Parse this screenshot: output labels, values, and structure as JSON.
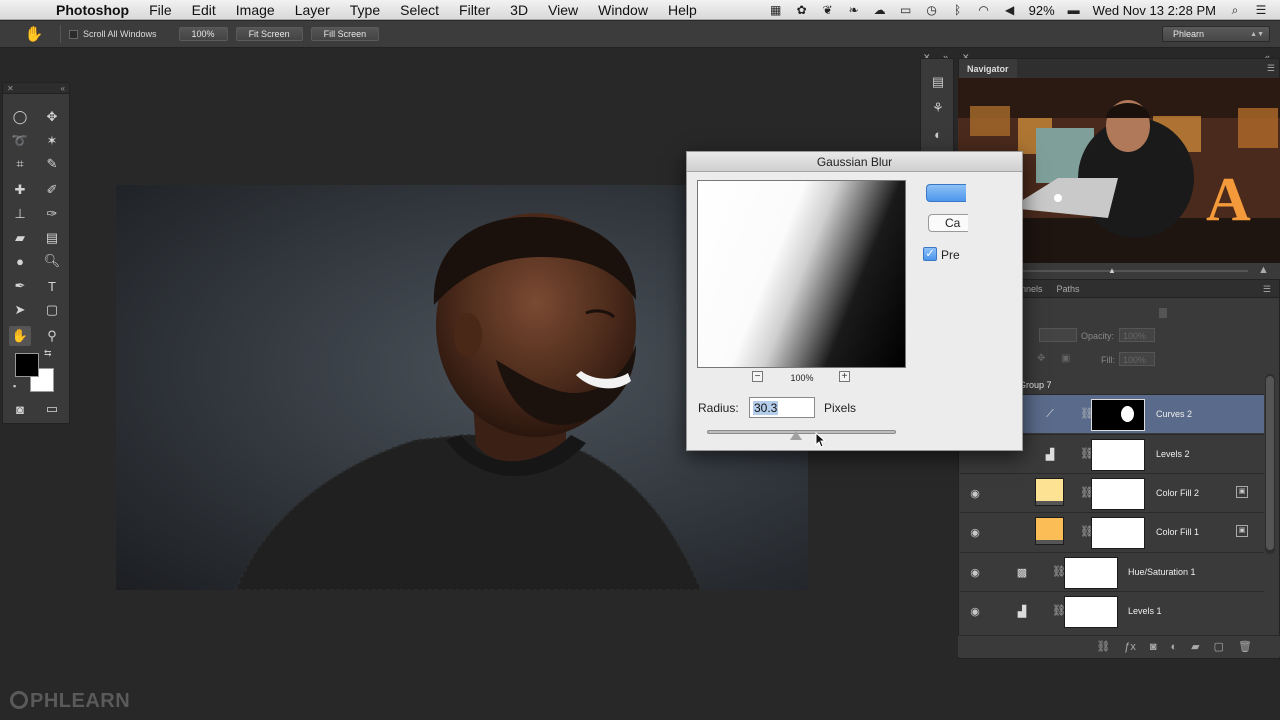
{
  "menubar": {
    "app": "Photoshop",
    "items": [
      "File",
      "Edit",
      "Image",
      "Layer",
      "Type",
      "Select",
      "Filter",
      "3D",
      "View",
      "Window",
      "Help"
    ],
    "battery": "92%",
    "datetime": "Wed Nov 13  2:28 PM"
  },
  "options": {
    "scroll_all": "Scroll All Windows",
    "zoom": "100%",
    "fit_screen": "Fit Screen",
    "fill_screen": "Fill Screen",
    "workspace": "Phlearn"
  },
  "dialog": {
    "title": "Gaussian Blur",
    "zoom": "100%",
    "radius_label": "Radius:",
    "radius_value": "30.3",
    "unit": "Pixels",
    "cancel_fragment": "Ca",
    "preview_fragment": "Pre",
    "preview_checked": true,
    "slider_fraction": 0.47
  },
  "navigator": {
    "tab": "Navigator"
  },
  "layers_panel": {
    "tabs": [
      "nnels",
      "Paths"
    ],
    "opacity_label": "Opacity:",
    "opacity_value": "100%",
    "fill_label": "Fill:",
    "fill_value": "100%",
    "group": "Group 7",
    "layers": [
      {
        "name": "Curves 2",
        "type": "curves-icon",
        "mask": "black",
        "selected": true
      },
      {
        "name": "Levels 2",
        "type": "levels-icon",
        "mask": "white",
        "selected": false
      },
      {
        "name": "Color Fill 2",
        "type": "fill",
        "color": "#fde293",
        "mask": "white",
        "selected": false
      },
      {
        "name": "Color Fill 1",
        "type": "fill",
        "color": "#fbbd55",
        "mask": "white",
        "selected": false
      },
      {
        "name": "Hue/Saturation 1",
        "type": "huesat-icon",
        "mask": "white",
        "selected": false
      },
      {
        "name": "Levels 1",
        "type": "levels-icon",
        "mask": "white",
        "selected": false
      }
    ]
  },
  "watermark": "PHLEARN",
  "colors": {
    "accent_blue": "#4d95ec",
    "selected_layer": "#5a6a8a"
  }
}
